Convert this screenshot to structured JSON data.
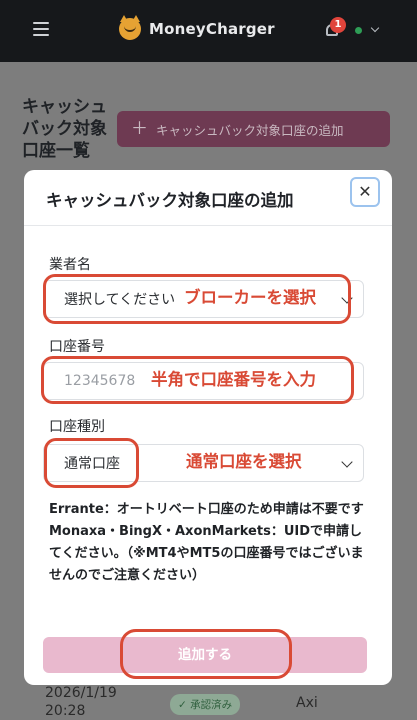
{
  "header": {
    "app_name": "MoneyCharger",
    "notification_count": "1"
  },
  "page": {
    "title": "キャッシュバック対象口座一覧",
    "add_button_label": "キャッシュバック対象口座の追加",
    "table": {
      "row": {
        "date": "2026/1/19",
        "time": "20:28",
        "status": "承認済み",
        "broker": "Axi"
      }
    }
  },
  "modal": {
    "title": "キャッシュバック対象口座の追加",
    "fields": {
      "broker": {
        "label": "業者名",
        "value": "選択してください"
      },
      "account_number": {
        "label": "口座番号",
        "placeholder": "12345678"
      },
      "account_type": {
        "label": "口座種別",
        "value": "通常口座"
      }
    },
    "notice_line1": "Errante：オートリベート口座のため申請は不要です",
    "notice_line2": "Monaxa・BingX・AxonMarkets：UIDで申請してください。（※MT4やMT5の口座番号ではございませんのでご注意ください）",
    "submit_label": "追加する"
  },
  "annotations": {
    "broker": "ブローカーを選択",
    "account_number": "半角で口座番号を入力",
    "account_type": "通常口座を選択",
    "color": "#d94a35"
  },
  "colors": {
    "brand_pink": "#e9b9ce",
    "topbar": "#16181b",
    "status_green": "#2e9d56"
  }
}
